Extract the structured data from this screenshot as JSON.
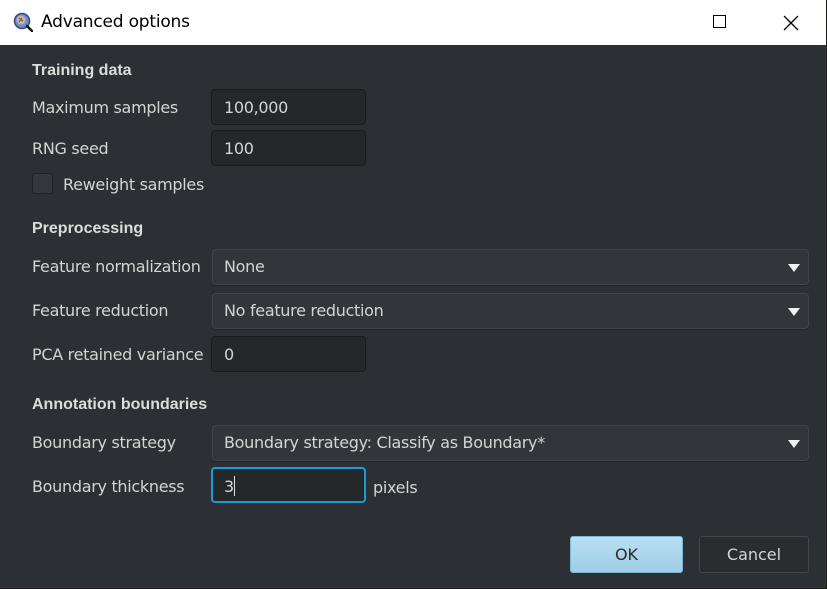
{
  "window": {
    "title": "Advanced options",
    "icon": "qupath-magnifier-icon",
    "controls": {
      "maximize": "maximize-icon",
      "close": "close-icon"
    }
  },
  "sections": {
    "training": {
      "title": "Training data",
      "max_samples_label": "Maximum samples",
      "max_samples_value": "100,000",
      "rng_seed_label": "RNG seed",
      "rng_seed_value": "100",
      "reweight_label": "Reweight samples",
      "reweight_checked": false
    },
    "preprocessing": {
      "title": "Preprocessing",
      "normalization_label": "Feature normalization",
      "normalization_value": "None",
      "reduction_label": "Feature reduction",
      "reduction_value": "No feature reduction",
      "pca_label": "PCA retained variance",
      "pca_value": "0"
    },
    "annotation": {
      "title": "Annotation boundaries",
      "strategy_label": "Boundary strategy",
      "strategy_value": "Boundary strategy: Classify as Boundary*",
      "thickness_label": "Boundary thickness",
      "thickness_value": "3",
      "thickness_unit": "pixels"
    }
  },
  "buttons": {
    "ok": "OK",
    "cancel": "Cancel"
  },
  "colors": {
    "accent_focus": "#1d9bd9",
    "ok_button": "#aad6ec",
    "background": "#2c2f33"
  }
}
